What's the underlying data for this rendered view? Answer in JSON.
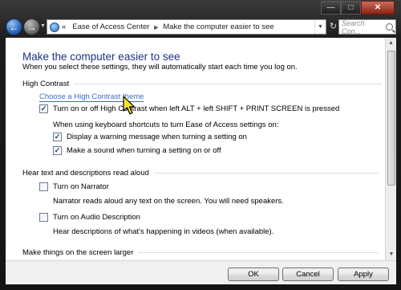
{
  "window": {
    "caption_buttons": [
      "minimize",
      "maximize",
      "close"
    ]
  },
  "nav": {
    "back_icon": "back-arrow-icon",
    "forward_icon": "forward-arrow-icon"
  },
  "address_bar": {
    "prefix": "«",
    "crumbs": [
      "Ease of Access Center",
      "Make the computer easier to see"
    ]
  },
  "search": {
    "placeholder": "Search Con..."
  },
  "page": {
    "title": "Make the computer easier to see",
    "subtitle": "When you select these settings, they will automatically start each time you log on."
  },
  "sections": {
    "high_contrast": "High Contrast",
    "narrator": "Hear text and descriptions read aloud",
    "larger": "Make things on the screen larger"
  },
  "high_contrast": {
    "choose_link": "Choose a High Contrast theme",
    "toggle_label": "Turn on or off High Contrast when left ALT + left SHIFT + PRINT SCREEN is pressed",
    "toggle_checked": true,
    "shortcut_intro": "When using keyboard shortcuts to turn Ease of Access settings on:",
    "warning_label": "Display a warning message when turning a setting on",
    "warning_checked": true,
    "sound_label": "Make a sound when turning a setting on or off",
    "sound_checked": true
  },
  "narrator": {
    "narrator_label": "Turn on Narrator",
    "narrator_checked": false,
    "narrator_desc": "Narrator reads aloud any text on the screen. You will need speakers.",
    "audio_label": "Turn on Audio Description",
    "audio_checked": false,
    "audio_desc": "Hear descriptions of what's happening in videos (when available)."
  },
  "buttons": {
    "ok": "OK",
    "cancel": "Cancel",
    "apply": "Apply"
  }
}
